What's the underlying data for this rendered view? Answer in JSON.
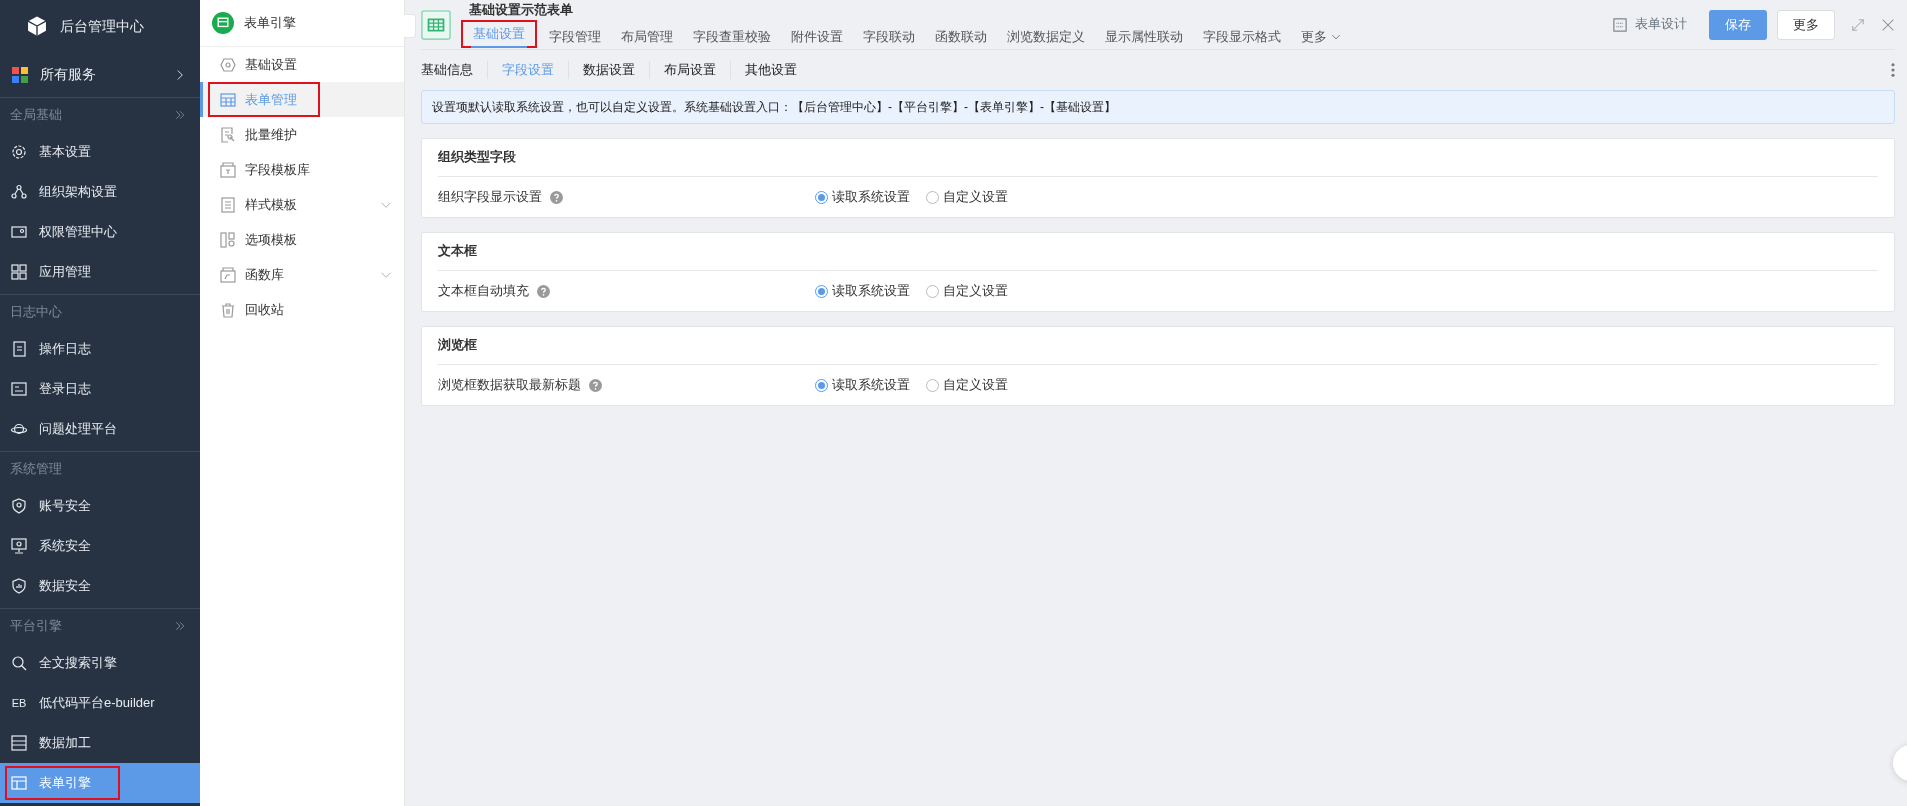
{
  "sidebar": {
    "title": "后台管理中心",
    "all_services": "所有服务",
    "groups": [
      {
        "label": "全局基础",
        "toggle": true,
        "items": [
          {
            "label": "基本设置",
            "selected": false,
            "highlighted": false
          },
          {
            "label": "组织架构设置",
            "selected": false,
            "highlighted": false
          },
          {
            "label": "权限管理中心",
            "selected": false,
            "highlighted": false
          },
          {
            "label": "应用管理",
            "selected": false,
            "highlighted": false
          }
        ]
      },
      {
        "label": "日志中心",
        "toggle": false,
        "items": [
          {
            "label": "操作日志",
            "selected": false,
            "highlighted": false
          },
          {
            "label": "登录日志",
            "selected": false,
            "highlighted": false
          },
          {
            "label": "问题处理平台",
            "selected": false,
            "highlighted": false
          }
        ]
      },
      {
        "label": "系统管理",
        "toggle": false,
        "items": [
          {
            "label": "账号安全",
            "selected": false,
            "highlighted": false
          },
          {
            "label": "系统安全",
            "selected": false,
            "highlighted": false
          },
          {
            "label": "数据安全",
            "selected": false,
            "highlighted": false
          }
        ]
      },
      {
        "label": "平台引擎",
        "toggle": true,
        "items": [
          {
            "label": "全文搜索引擎",
            "selected": false,
            "highlighted": false
          },
          {
            "label": "低代码平台e-builder",
            "icon_text": "EB",
            "selected": false,
            "highlighted": false
          },
          {
            "label": "数据加工",
            "selected": false,
            "highlighted": false
          },
          {
            "label": "表单引擎",
            "selected": true,
            "highlighted": true
          }
        ]
      }
    ]
  },
  "subnav": {
    "title": "表单引擎",
    "items": [
      {
        "label": "基础设置",
        "selected": false,
        "expandable": false,
        "highlighted": false
      },
      {
        "label": "表单管理",
        "selected": true,
        "expandable": false,
        "highlighted": true
      },
      {
        "label": "批量维护",
        "selected": false,
        "expandable": false,
        "highlighted": false
      },
      {
        "label": "字段模板库",
        "selected": false,
        "expandable": false,
        "highlighted": false
      },
      {
        "label": "样式模板",
        "selected": false,
        "expandable": true,
        "highlighted": false
      },
      {
        "label": "选项模板",
        "selected": false,
        "expandable": false,
        "highlighted": false
      },
      {
        "label": "函数库",
        "selected": false,
        "expandable": true,
        "highlighted": false
      },
      {
        "label": "回收站",
        "selected": false,
        "expandable": false,
        "highlighted": false
      }
    ]
  },
  "header": {
    "title": "基础设置示范表单",
    "tabs": [
      {
        "label": "基础设置",
        "selected": true,
        "highlighted": true
      },
      {
        "label": "字段管理",
        "selected": false,
        "highlighted": false
      },
      {
        "label": "布局管理",
        "selected": false,
        "highlighted": false
      },
      {
        "label": "字段查重校验",
        "selected": false,
        "highlighted": false
      },
      {
        "label": "附件设置",
        "selected": false,
        "highlighted": false
      },
      {
        "label": "字段联动",
        "selected": false,
        "highlighted": false
      },
      {
        "label": "函数联动",
        "selected": false,
        "highlighted": false
      },
      {
        "label": "浏览数据定义",
        "selected": false,
        "highlighted": false
      },
      {
        "label": "显示属性联动",
        "selected": false,
        "highlighted": false
      },
      {
        "label": "字段显示格式",
        "selected": false,
        "highlighted": false
      }
    ],
    "more_tabs": "更多",
    "design": "表单设计",
    "save": "保存",
    "more": "更多"
  },
  "subtabs": [
    {
      "label": "基础信息",
      "selected": false
    },
    {
      "label": "字段设置",
      "selected": true
    },
    {
      "label": "数据设置",
      "selected": false
    },
    {
      "label": "布局设置",
      "selected": false
    },
    {
      "label": "其他设置",
      "selected": false
    }
  ],
  "notice": "设置项默认读取系统设置，也可以自定义设置。系统基础设置入口：【后台管理中心】-【平台引擎】-【表单引擎】-【基础设置】",
  "sections": [
    {
      "title": "组织类型字段",
      "label": "组织字段显示设置",
      "options": [
        {
          "label": "读取系统设置",
          "selected": true
        },
        {
          "label": "自定义设置",
          "selected": false
        }
      ]
    },
    {
      "title": "文本框",
      "label": "文本框自动填充",
      "options": [
        {
          "label": "读取系统设置",
          "selected": true
        },
        {
          "label": "自定义设置",
          "selected": false
        }
      ]
    },
    {
      "title": "浏览框",
      "label": "浏览框数据获取最新标题",
      "options": [
        {
          "label": "读取系统设置",
          "selected": true
        },
        {
          "label": "自定义设置",
          "selected": false
        }
      ]
    }
  ]
}
